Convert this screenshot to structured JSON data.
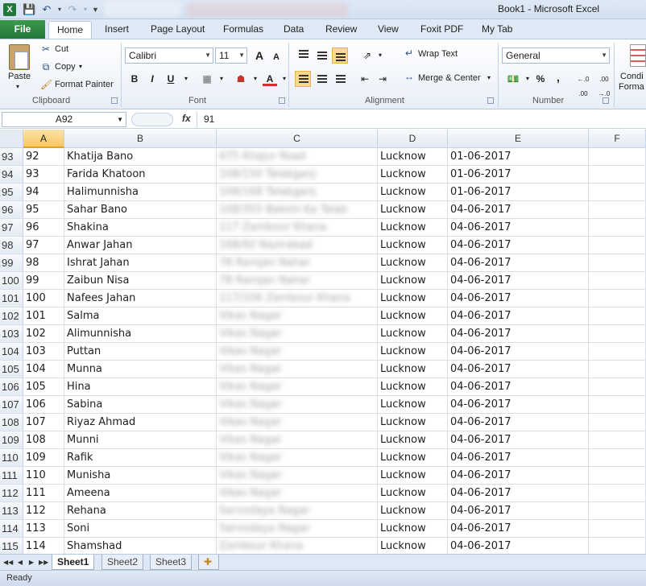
{
  "window": {
    "title": "Book1 - Microsoft Excel"
  },
  "ribbon": {
    "tabs": [
      "File",
      "Home",
      "Insert",
      "Page Layout",
      "Formulas",
      "Data",
      "Review",
      "View",
      "Foxit PDF",
      "My Tab"
    ],
    "active_tab": "Home",
    "clipboard": {
      "paste": "Paste",
      "cut": "Cut",
      "copy": "Copy",
      "format_painter": "Format Painter",
      "group_label": "Clipboard"
    },
    "font": {
      "name": "Calibri",
      "size": "11",
      "bold": "B",
      "italic": "I",
      "underline": "U",
      "grow": "A",
      "shrink": "A",
      "font_color": "A",
      "group_label": "Font"
    },
    "alignment": {
      "wrap_text": "Wrap Text",
      "merge_center": "Merge & Center",
      "group_label": "Alignment"
    },
    "number": {
      "format": "General",
      "percent": "%",
      "comma": ",",
      "inc_decimal": "←.0 .00",
      "dec_decimal": ".00 →.0",
      "group_label": "Number"
    },
    "styles": {
      "conditional_line1": "Condi",
      "conditional_line2": "Forma"
    }
  },
  "formula_bar": {
    "name_box": "A92",
    "fx": "fx",
    "content": "91"
  },
  "columns": [
    "A",
    "B",
    "C",
    "D",
    "E",
    "F"
  ],
  "rows": [
    {
      "num": "93",
      "a": "92",
      "b": "Khatija Bano",
      "c": "675 Khajur Road",
      "d": "Lucknow",
      "e": "01-06-2017"
    },
    {
      "num": "94",
      "a": "93",
      "b": "Farida Khatoon",
      "c": "108/150 Talabganj",
      "d": "Lucknow",
      "e": "01-06-2017"
    },
    {
      "num": "95",
      "a": "94",
      "b": "Halimunnisha",
      "c": "108/168 Talabganj",
      "d": "Lucknow",
      "e": "01-06-2017"
    },
    {
      "num": "96",
      "a": "95",
      "b": "Sahar Bano",
      "c": "108/355 Bakshi Ka Talab",
      "d": "Lucknow",
      "e": "04-06-2017"
    },
    {
      "num": "97",
      "a": "96",
      "b": "Shakina",
      "c": "117 Zambour Khana",
      "d": "Lucknow",
      "e": "04-06-2017"
    },
    {
      "num": "98",
      "a": "97",
      "b": "Anwar Jahan",
      "c": "168/92 Nazirabad",
      "d": "Lucknow",
      "e": "04-06-2017"
    },
    {
      "num": "99",
      "a": "98",
      "b": "Ishrat Jahan",
      "c": "78 Ramjan Nahar",
      "d": "Lucknow",
      "e": "04-06-2017"
    },
    {
      "num": "100",
      "a": "99",
      "b": "Zaibun Nisa",
      "c": "78 Ramjan Nahar",
      "d": "Lucknow",
      "e": "04-06-2017"
    },
    {
      "num": "101",
      "a": "100",
      "b": "Nafees Jahan",
      "c": "117/106 Zambour Khana",
      "d": "Lucknow",
      "e": "04-06-2017"
    },
    {
      "num": "102",
      "a": "101",
      "b": "Salma",
      "c": "Vikas Nagar",
      "d": "Lucknow",
      "e": "04-06-2017"
    },
    {
      "num": "103",
      "a": "102",
      "b": "Alimunnisha",
      "c": "Vikas Nagar",
      "d": "Lucknow",
      "e": "04-06-2017"
    },
    {
      "num": "104",
      "a": "103",
      "b": "Puttan",
      "c": "Vikas Nagar",
      "d": "Lucknow",
      "e": "04-06-2017"
    },
    {
      "num": "105",
      "a": "104",
      "b": "Munna",
      "c": "Vikas Nagar",
      "d": "Lucknow",
      "e": "04-06-2017"
    },
    {
      "num": "106",
      "a": "105",
      "b": "Hina",
      "c": "Vikas Nagar",
      "d": "Lucknow",
      "e": "04-06-2017"
    },
    {
      "num": "107",
      "a": "106",
      "b": "Sabina",
      "c": "Vikas Nagar",
      "d": "Lucknow",
      "e": "04-06-2017"
    },
    {
      "num": "108",
      "a": "107",
      "b": "Riyaz Ahmad",
      "c": "Vikas Nagar",
      "d": "Lucknow",
      "e": "04-06-2017"
    },
    {
      "num": "109",
      "a": "108",
      "b": "Munni",
      "c": "Vikas Nagar",
      "d": "Lucknow",
      "e": "04-06-2017"
    },
    {
      "num": "110",
      "a": "109",
      "b": "Rafik",
      "c": "Vikas Nagar",
      "d": "Lucknow",
      "e": "04-06-2017"
    },
    {
      "num": "111",
      "a": "110",
      "b": "Munisha",
      "c": "Vikas Nagar",
      "d": "Lucknow",
      "e": "04-06-2017"
    },
    {
      "num": "112",
      "a": "111",
      "b": "Ameena",
      "c": "Vikas Nagar",
      "d": "Lucknow",
      "e": "04-06-2017"
    },
    {
      "num": "113",
      "a": "112",
      "b": "Rehana",
      "c": "Sarvodaya Nagar",
      "d": "Lucknow",
      "e": "04-06-2017"
    },
    {
      "num": "114",
      "a": "113",
      "b": "Soni",
      "c": "Sarvodaya Nagar",
      "d": "Lucknow",
      "e": "04-06-2017"
    },
    {
      "num": "115",
      "a": "114",
      "b": "Shamshad",
      "c": "Zambour Khana",
      "d": "Lucknow",
      "e": "04-06-2017"
    }
  ],
  "sheets": [
    "Sheet1",
    "Sheet2",
    "Sheet3"
  ],
  "active_sheet": "Sheet1",
  "status": "Ready",
  "colors": {
    "file_tab": "#2e8b42",
    "selected_header": "#f7c861",
    "ribbon_bg": "#dfe9f5",
    "excel_green": "#1f7a3a"
  }
}
